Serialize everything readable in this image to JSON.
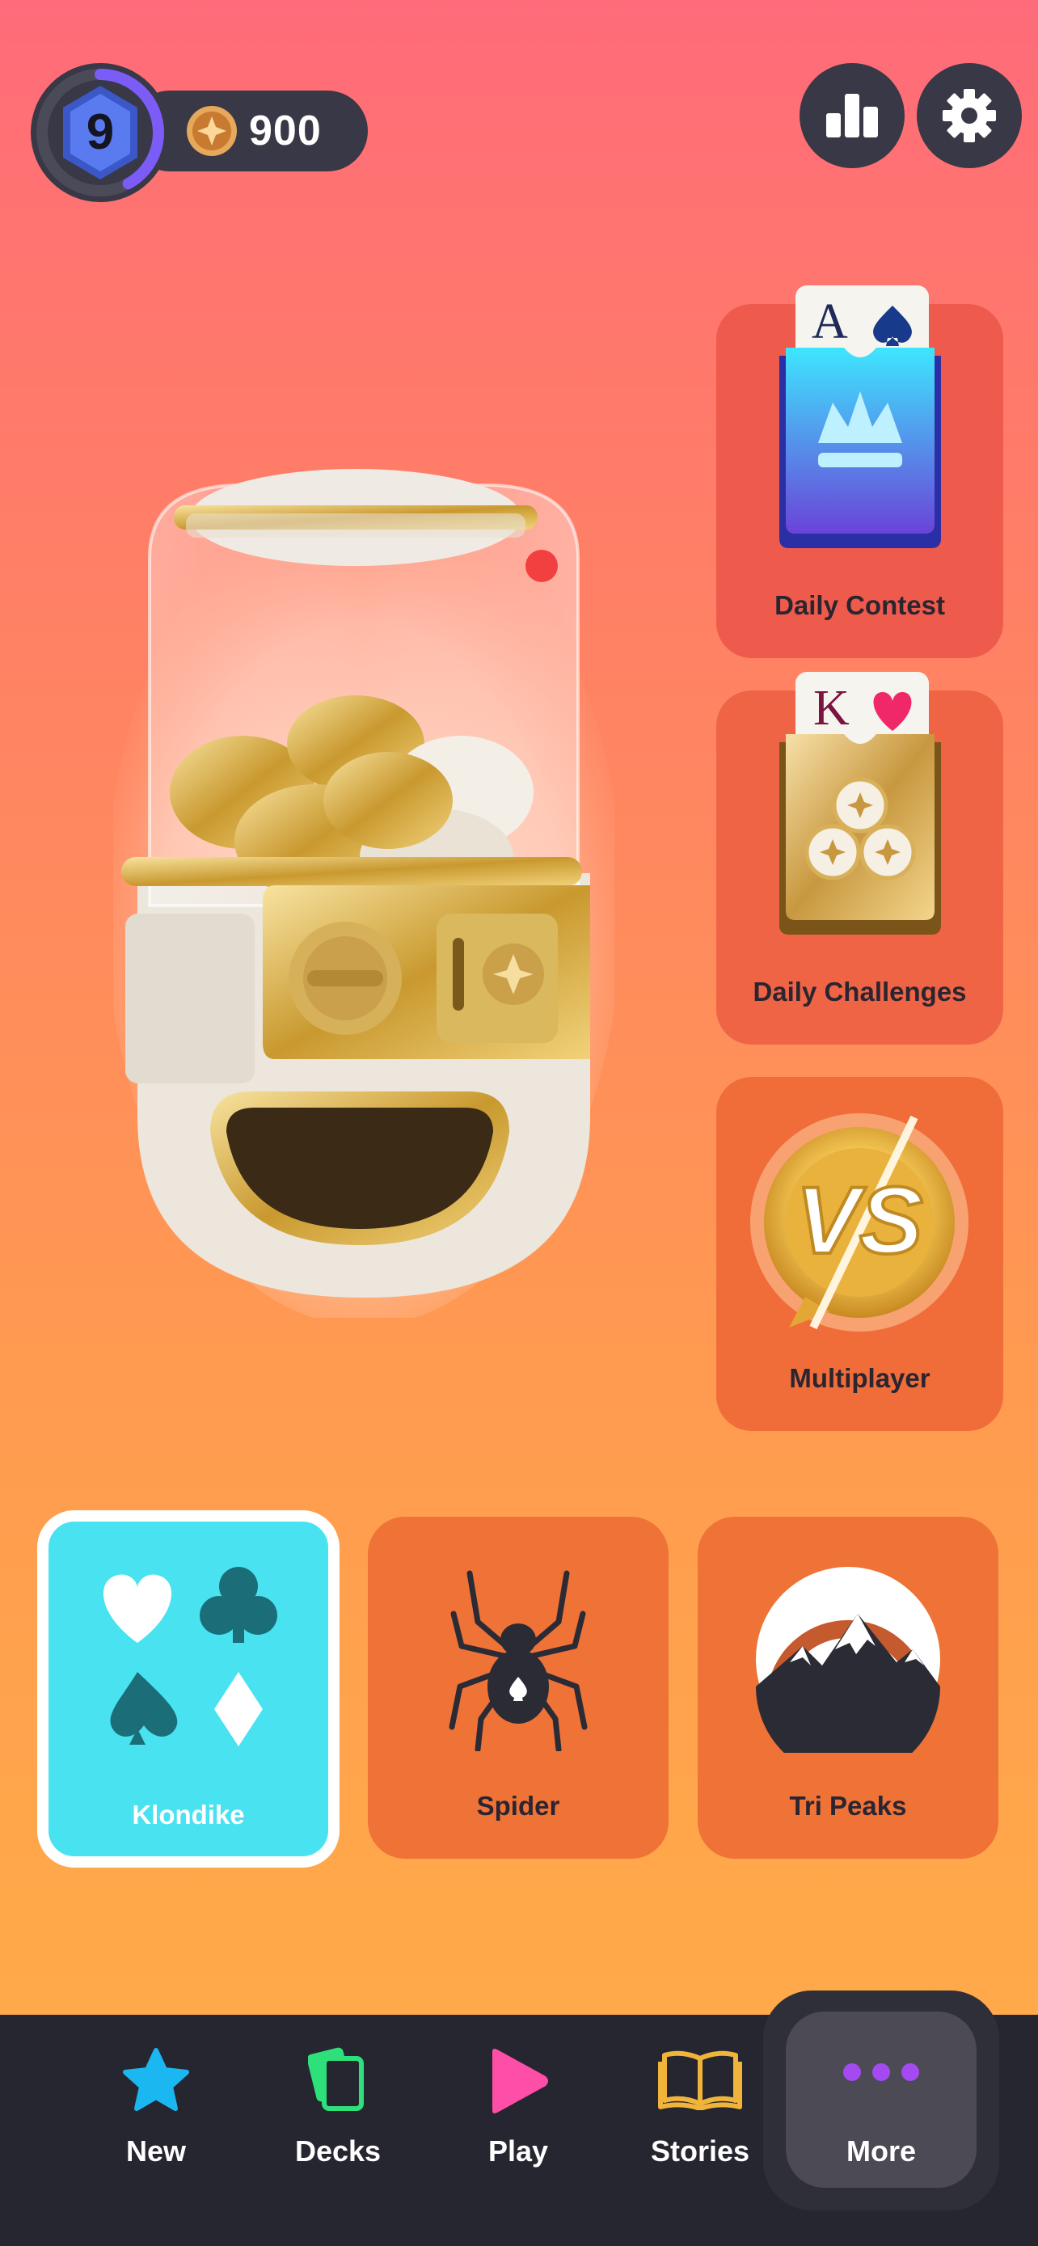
{
  "header": {
    "level": "9",
    "level_progress": 0.42,
    "coins": "900"
  },
  "side_tiles": [
    {
      "id": "daily-contest",
      "label": "Daily Contest",
      "card_rank": "A",
      "card_suit": "spade"
    },
    {
      "id": "daily-challenges",
      "label": "Daily Challenges",
      "card_rank": "K",
      "card_suit": "heart"
    },
    {
      "id": "multiplayer",
      "label": "Multiplayer",
      "badge_text": "VS"
    }
  ],
  "modes": [
    {
      "id": "klondike",
      "label": "Klondike",
      "active": true
    },
    {
      "id": "spider",
      "label": "Spider",
      "active": false
    },
    {
      "id": "tri-peaks",
      "label": "Tri Peaks",
      "active": false
    }
  ],
  "nav": [
    {
      "id": "new",
      "label": "New",
      "icon": "star-icon"
    },
    {
      "id": "decks",
      "label": "Decks",
      "icon": "cards-icon"
    },
    {
      "id": "play",
      "label": "Play",
      "icon": "play-icon"
    },
    {
      "id": "stories",
      "label": "Stories",
      "icon": "book-icon"
    },
    {
      "id": "more",
      "label": "More",
      "icon": "dots-icon",
      "active": true
    }
  ],
  "colors": {
    "accent_cyan": "#48e2f1",
    "nav_bg": "#262630",
    "star": "#1ab7f0",
    "decks": "#2ee07a",
    "play": "#ff4ea8",
    "stories": "#f0b43a",
    "more": "#a34af0"
  }
}
